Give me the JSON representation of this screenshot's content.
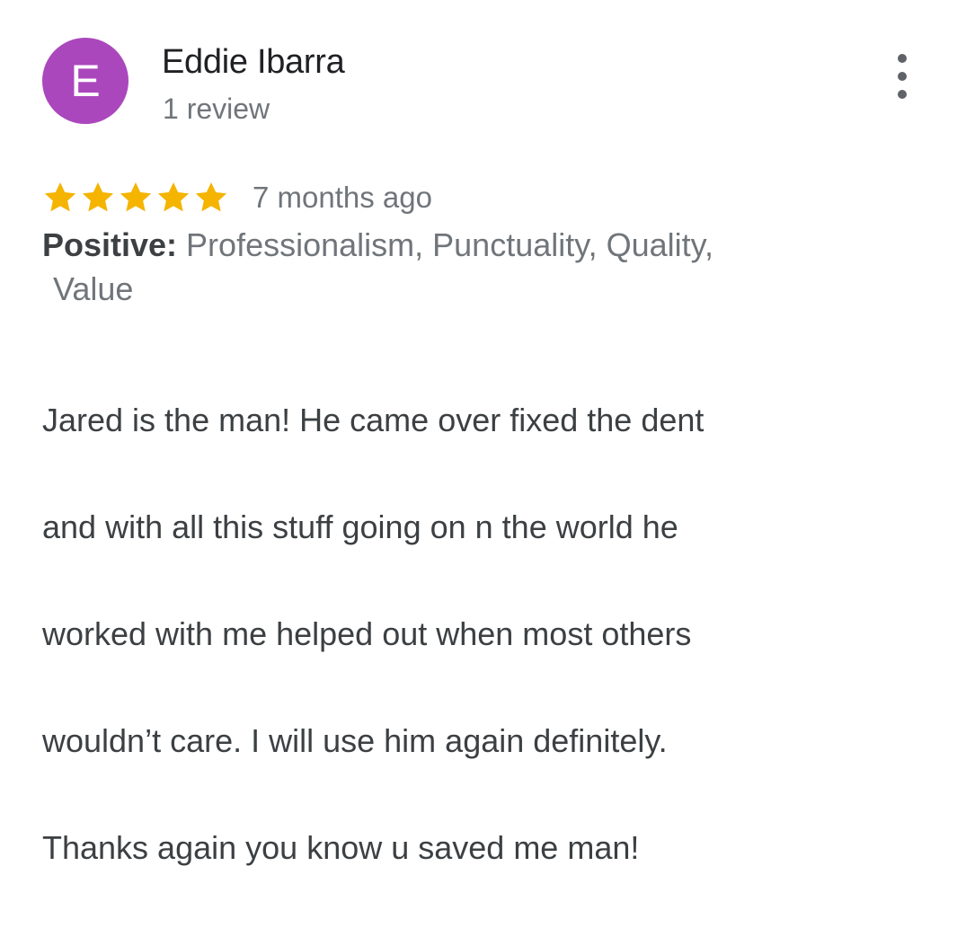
{
  "reviewer": {
    "initial": "E",
    "avatar_color": "#ab47bc",
    "name": "Eddie Ibarra",
    "review_count": "1 review"
  },
  "menu": {
    "icon": "more-vert-icon"
  },
  "rating": {
    "stars": 5,
    "max_stars": 5,
    "star_color": "#f4b400",
    "date": "7 months ago"
  },
  "attributes": {
    "label": "Positive:",
    "values_line1": " Professionalism, Punctuality, Quality,",
    "values_line2": "Value"
  },
  "review": {
    "text_lines": [
      "Jared is the man! He came over fixed the dent",
      "and with all this stuff going on n the world he",
      "worked with me helped out when most others",
      "wouldn’t care. I will use him again definitely.",
      "Thanks again you know u saved me man!"
    ]
  }
}
